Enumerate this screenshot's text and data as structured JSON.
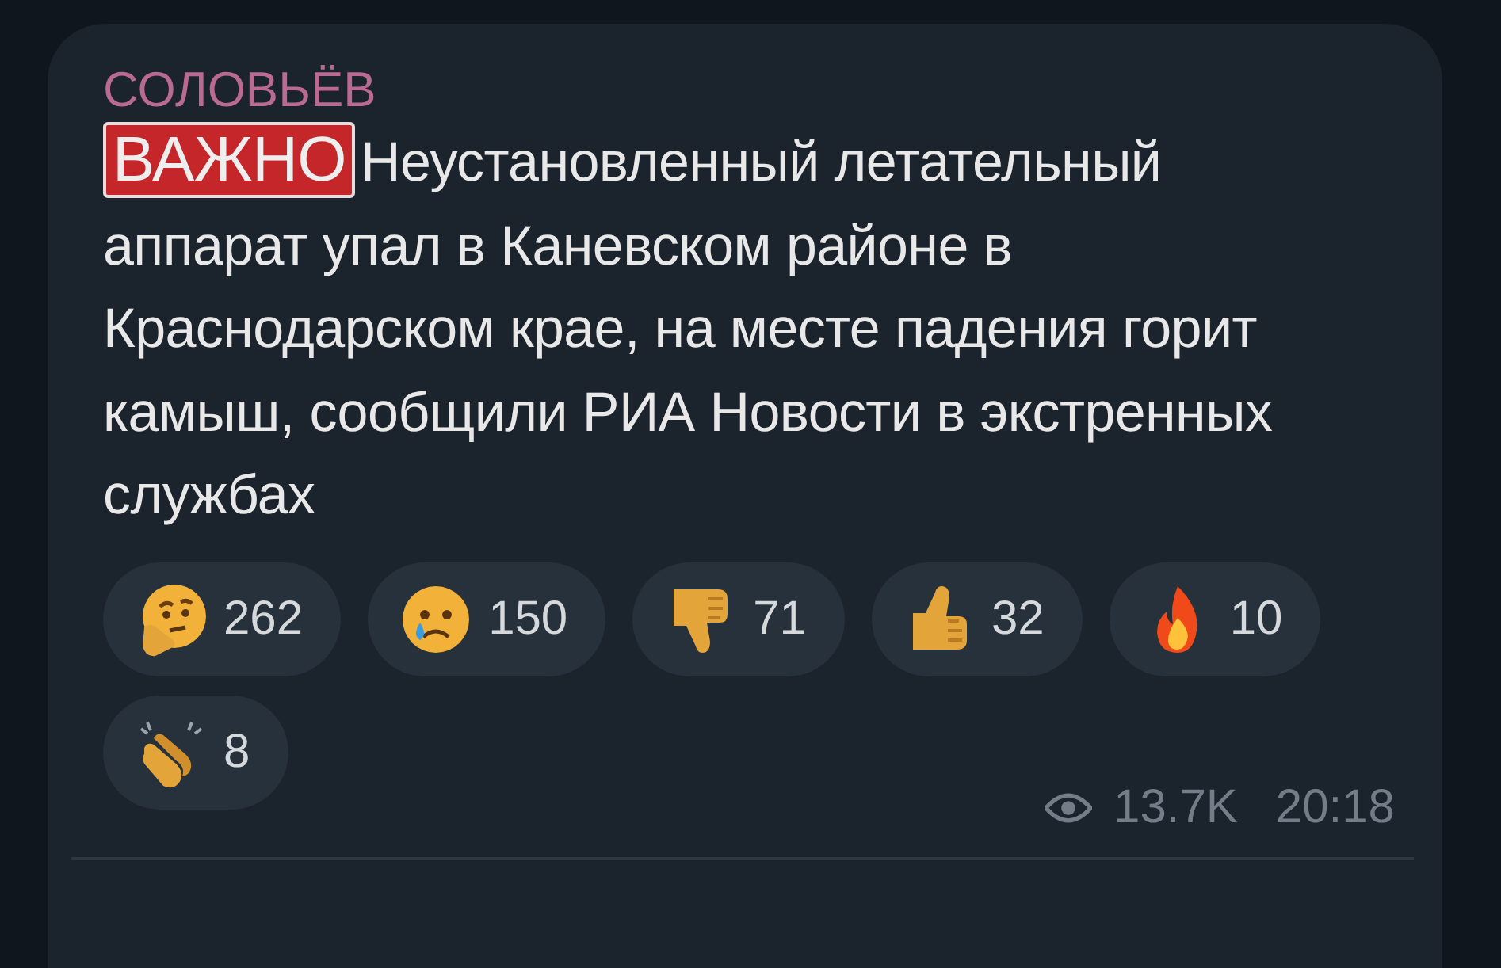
{
  "message": {
    "channel": "СОЛОВЬЁВ",
    "badge": "ВАЖНО",
    "text": "Неустановленный летательный аппарат упал в Каневском районе в Краснодарском крае, на месте падения горит камыш, сообщили РИА Новости в экстренных службах",
    "reactions": [
      {
        "kind": "thinking",
        "count": "262"
      },
      {
        "kind": "crying",
        "count": "150"
      },
      {
        "kind": "thumbs-down",
        "count": "71"
      },
      {
        "kind": "thumbs-up",
        "count": "32"
      },
      {
        "kind": "fire",
        "count": "10"
      },
      {
        "kind": "clap",
        "count": "8"
      }
    ],
    "views": "13.7K",
    "time": "20:18"
  }
}
